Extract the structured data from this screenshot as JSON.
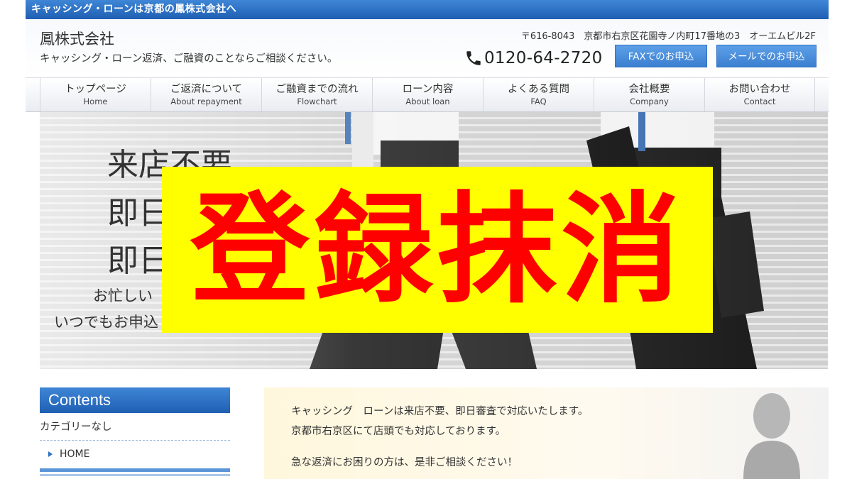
{
  "topbar": {
    "text": "キャッシング・ローンは京都の鳳株式会社へ"
  },
  "header": {
    "company": "鳳株式会社",
    "tagline": "キャッシング・ローン返済、ご融資のことならご相談ください。",
    "address": "〒616-8043　京都市右京区花園寺ノ内町17番地の3　オーエムビル2F",
    "phone": "0120-64-2720",
    "fax_button": "FAXでのお申込",
    "mail_button": "メールでのお申込"
  },
  "nav": {
    "items": [
      {
        "jp": "トップページ",
        "en": "Home"
      },
      {
        "jp": "ご返済について",
        "en": "About repayment"
      },
      {
        "jp": "ご融資までの流れ",
        "en": "Flowchart"
      },
      {
        "jp": "ローン内容",
        "en": "About loan"
      },
      {
        "jp": "よくある質問",
        "en": "FAQ"
      },
      {
        "jp": "会社概要",
        "en": "Company"
      },
      {
        "jp": "お問い合わせ",
        "en": "Contact"
      }
    ]
  },
  "hero": {
    "line1": "来店不要",
    "line2": "即日",
    "line3": "即日",
    "line4": "お忙しい",
    "line5": "いつでもお申込"
  },
  "stamp": {
    "text": "登録抹消"
  },
  "sidebar": {
    "heading": "Contents",
    "category": "カテゴリーなし",
    "home_link": "HOME"
  },
  "main": {
    "line1": "キャッシング　ローンは来店不要、即日審査で対応いたします。",
    "line2": "京都市右京区にて店頭でも対応しております。",
    "line3": "急な返済にお困りの方は、是非ご相談ください！"
  },
  "colors": {
    "brand_blue": "#1f5fb3",
    "stamp_yellow": "#ffff00",
    "stamp_red": "#ff0000"
  },
  "icons": {
    "phone": "phone-icon",
    "arrow": "triangle-right-icon"
  }
}
